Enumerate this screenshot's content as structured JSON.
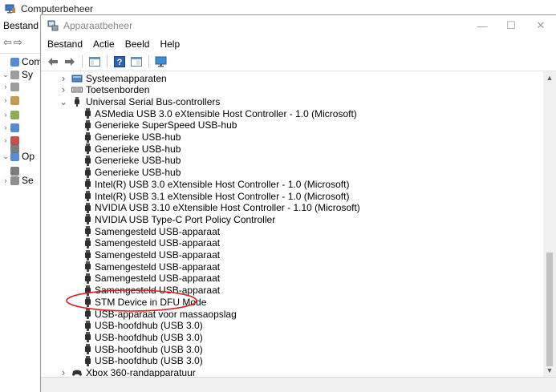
{
  "background_window": {
    "title": "Computerbeheer",
    "menu": [
      "Bestand"
    ],
    "tree": [
      {
        "label": "Comp",
        "chevron": ""
      },
      {
        "label": "Sy",
        "chevron": "v"
      },
      {
        "label": "",
        "chevron": ">"
      },
      {
        "label": "",
        "chevron": ">"
      },
      {
        "label": "",
        "chevron": ">"
      },
      {
        "label": "",
        "chevron": ">"
      },
      {
        "label": "",
        "chevron": ">"
      },
      {
        "label": "",
        "chevron": ""
      },
      {
        "label": "Op",
        "chevron": "v"
      },
      {
        "label": "",
        "chevron": ""
      },
      {
        "label": "Se",
        "chevron": ">"
      }
    ]
  },
  "window": {
    "title": "Apparaatbeheer",
    "controls": {
      "minimize": "—",
      "maximize": "☐",
      "close": "✕"
    }
  },
  "menu": {
    "file": "Bestand",
    "action": "Actie",
    "view": "Beeld",
    "help": "Help"
  },
  "tree": {
    "categories_top": [
      {
        "label": "Systeemapparaten",
        "expanded": false,
        "icon": "system-devices-icon"
      },
      {
        "label": "Toetsenborden",
        "expanded": false,
        "icon": "keyboard-icon"
      },
      {
        "label": "Universal Serial Bus-controllers",
        "expanded": true,
        "icon": "usb-icon"
      }
    ],
    "usb_devices": [
      "ASMedia USB 3.0 eXtensible Host Controller - 1.0 (Microsoft)",
      "Generieke SuperSpeed USB-hub",
      "Generieke USB-hub",
      "Generieke USB-hub",
      "Generieke USB-hub",
      "Generieke USB-hub",
      "Intel(R) USB 3.0 eXtensible Host Controller - 1.0 (Microsoft)",
      "Intel(R) USB 3.1 eXtensible Host Controller - 1.0 (Microsoft)",
      "NVIDIA USB 3.10 eXtensible Host Controller - 1.10 (Microsoft)",
      "NVIDIA USB Type-C Port Policy Controller",
      "Samengesteld USB-apparaat",
      "Samengesteld USB-apparaat",
      "Samengesteld USB-apparaat",
      "Samengesteld USB-apparaat",
      "Samengesteld USB-apparaat",
      "Samengesteld USB-apparaat",
      "STM Device in DFU Mode",
      "USB-apparaat voor massaopslag",
      "USB-hoofdhub (USB 3.0)",
      "USB-hoofdhub (USB 3.0)",
      "USB-hoofdhub (USB 3.0)",
      "USB-hoofdhub (USB 3.0)"
    ],
    "categories_bottom": [
      {
        "label": "Xbox 360-randapparatuur",
        "expanded": false,
        "icon": "xbox-controller-icon"
      }
    ],
    "highlighted_device": "STM Device in DFU Mode"
  },
  "colors": {
    "highlight_ellipse": "#e02020",
    "tree_chevron": "#666666"
  }
}
